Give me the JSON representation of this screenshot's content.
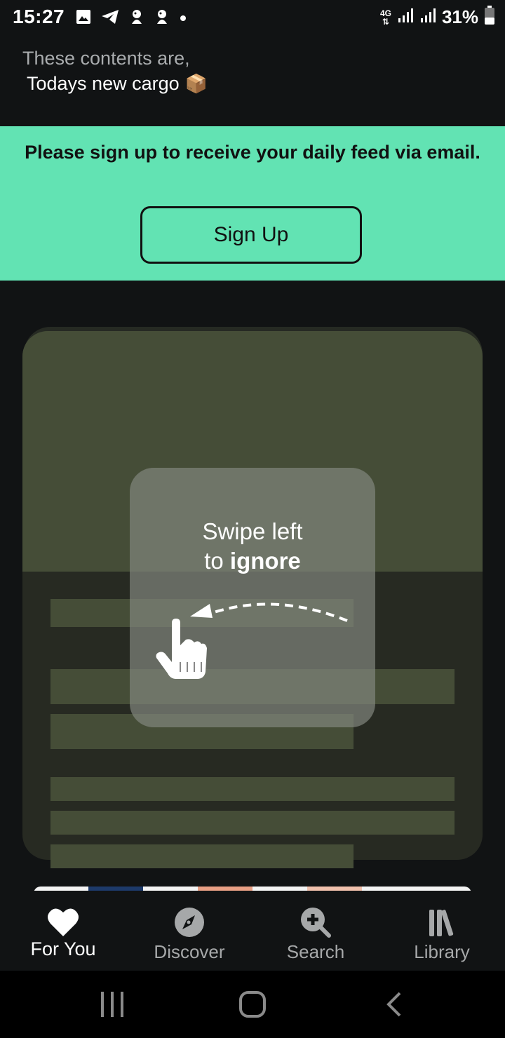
{
  "status_bar": {
    "time": "15:27",
    "network": "4G",
    "battery": "31%",
    "icons": [
      "gallery-icon",
      "telegram-icon",
      "premier-league-icon",
      "premier-league-icon",
      "dot-icon",
      "signal-icon",
      "signal-icon",
      "battery-icon"
    ]
  },
  "header": {
    "line1": "These contents are,",
    "line2": "Todays new cargo",
    "emoji": "📦"
  },
  "banner": {
    "text": "Please sign up to receive your daily feed via email.",
    "button_label": "Sign Up",
    "color": "#62e3b3"
  },
  "tutorial": {
    "line1": "Swipe left",
    "line2_prefix": "to ",
    "line2_bold": "ignore"
  },
  "bottom_nav": {
    "items": [
      {
        "label": "For You",
        "icon": "heart-icon",
        "active": true
      },
      {
        "label": "Discover",
        "icon": "compass-icon",
        "active": false
      },
      {
        "label": "Search",
        "icon": "search-plus-icon",
        "active": false
      },
      {
        "label": "Library",
        "icon": "library-icon",
        "active": false
      }
    ]
  },
  "system_nav": [
    "recents-icon",
    "home-icon",
    "back-icon"
  ]
}
